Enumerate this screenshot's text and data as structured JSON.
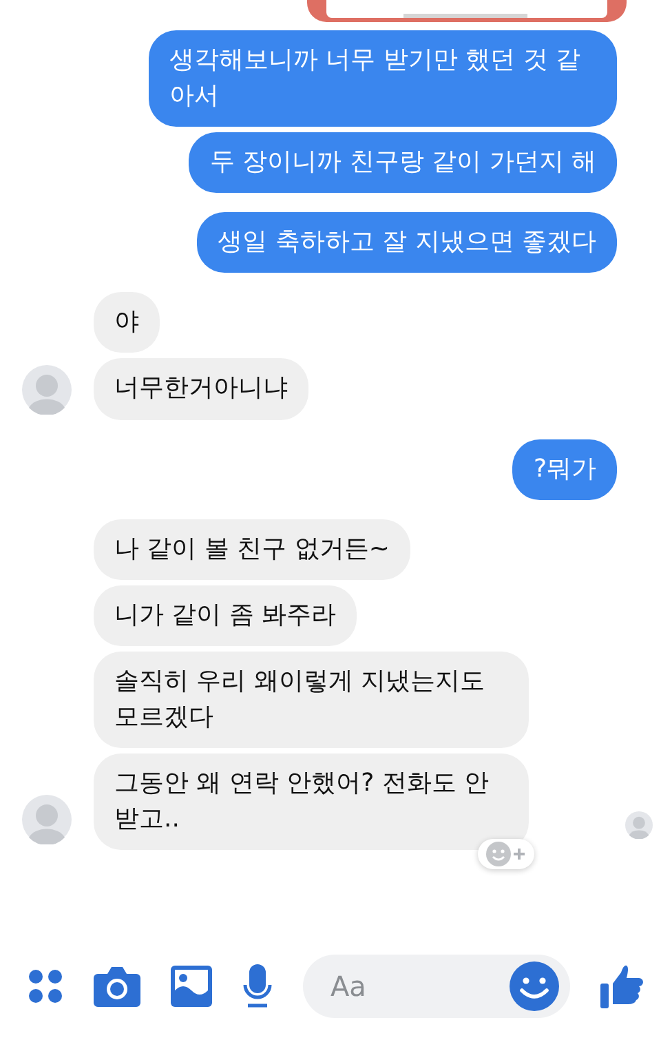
{
  "groups": [
    {
      "kind": "sent",
      "messages": [
        "생각해보니까 너무 받기만 했던 것 같아서",
        "두 장이니까 친구랑 같이 가던지 해"
      ]
    },
    {
      "kind": "sent",
      "messages": [
        "생일 축하하고 잘 지냈으면 좋겠다"
      ]
    },
    {
      "kind": "received",
      "messages": [
        "야",
        "너무한거아니냐"
      ],
      "seen": false,
      "reaction_button": false
    },
    {
      "kind": "sent",
      "messages": [
        "?뭐가"
      ]
    },
    {
      "kind": "received",
      "messages": [
        "나 같이 볼 친구 없거든~",
        "니가 같이 좀 봐주라",
        "솔직히 우리 왜이렇게 지냈는지도 모르겠다",
        "그동안 왜 연락 안했어? 전화도 안 받고.."
      ],
      "seen": true,
      "reaction_button": true
    }
  ],
  "composer": {
    "placeholder": "Aa"
  }
}
